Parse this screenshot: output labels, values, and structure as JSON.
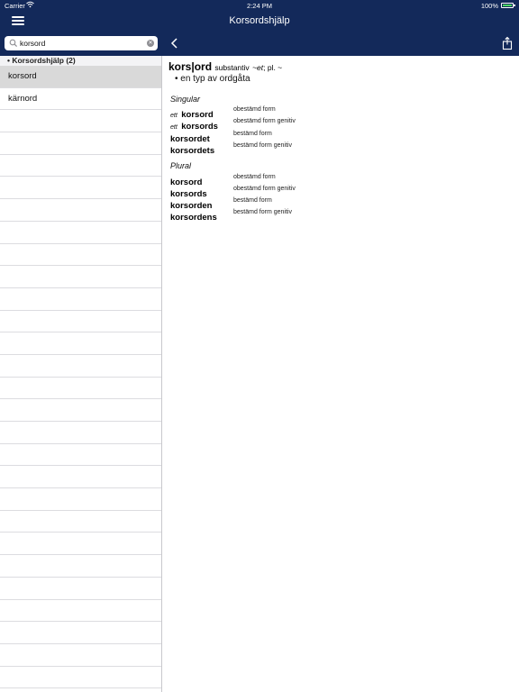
{
  "status_bar": {
    "carrier": "Carrier",
    "time": "2:24 PM",
    "battery": "100%",
    "battery_color": "#4cd964"
  },
  "header": {
    "title": "Korsordshjälp",
    "background": "#13295a",
    "menu_icon": "hamburger-icon",
    "back_icon": "chevron-left-icon",
    "share_icon": "share-icon"
  },
  "search": {
    "value": "korsord",
    "search_icon": "magnifier-icon",
    "clear_icon": "clear-icon"
  },
  "sidebar": {
    "section_header": "• Korsordshjälp (2)",
    "items": [
      {
        "label": "korsord",
        "selected": true
      },
      {
        "label": "kärnord",
        "selected": false
      }
    ]
  },
  "entry": {
    "headword": "kors|ord",
    "part_of_speech": "substantiv",
    "forms_main": "~et",
    "forms_sep": ";",
    "forms_plural": "pl. ~",
    "definition": "• en typ av ordgåta",
    "groups": [
      {
        "label": "Singular",
        "rows": [
          {
            "article": "ett",
            "form": "korsord",
            "desc": "obestämd form"
          },
          {
            "article": "ett",
            "form": "korsords",
            "desc": "obestämd form genitiv"
          },
          {
            "article": "",
            "form": "korsordet",
            "desc": "bestämd form"
          },
          {
            "article": "",
            "form": "korsordets",
            "desc": "bestämd form genitiv"
          }
        ]
      },
      {
        "label": "Plural",
        "rows": [
          {
            "article": "",
            "form": "korsord",
            "desc": "obestämd form"
          },
          {
            "article": "",
            "form": "korsords",
            "desc": "obestämd form genitiv"
          },
          {
            "article": "",
            "form": "korsorden",
            "desc": "bestämd form"
          },
          {
            "article": "",
            "form": "korsordens",
            "desc": "bestämd form genitiv"
          }
        ]
      }
    ]
  }
}
